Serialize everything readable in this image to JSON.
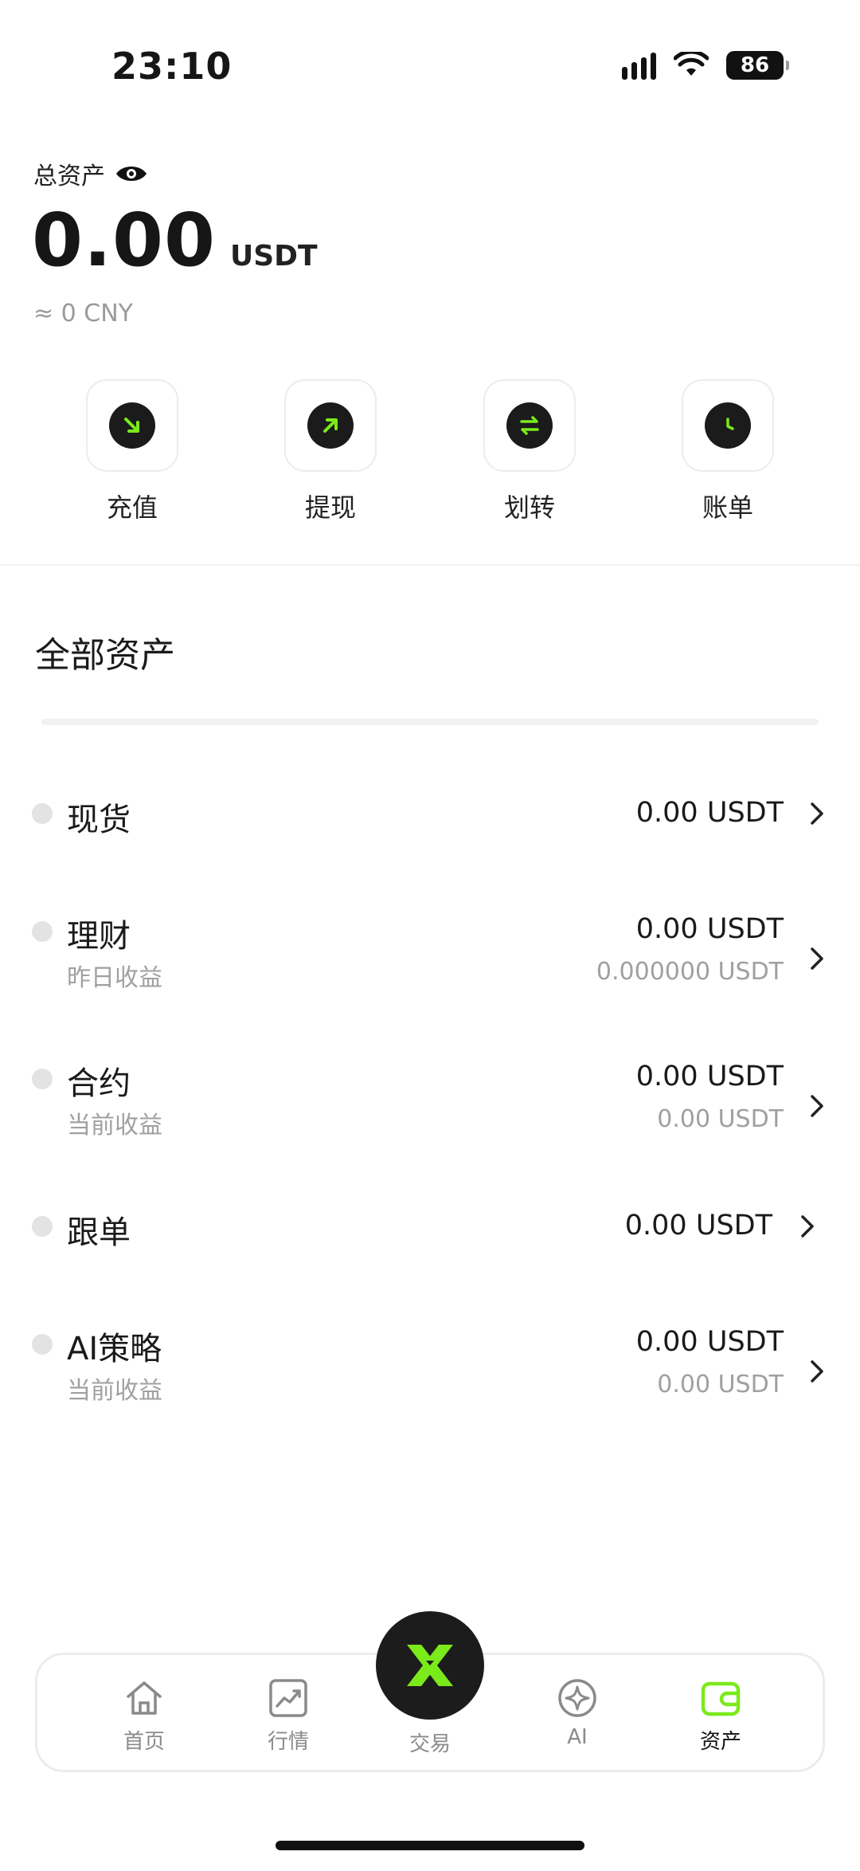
{
  "status_bar": {
    "time": "23:10",
    "battery": "86"
  },
  "header": {
    "total_label": "总资产",
    "total_amount": "0.00",
    "total_unit": "USDT",
    "total_cny": "≈ 0 CNY"
  },
  "actions": [
    {
      "label": "充值",
      "icon": "deposit-arrow-icon"
    },
    {
      "label": "提现",
      "icon": "withdraw-arrow-icon"
    },
    {
      "label": "划转",
      "icon": "transfer-icon"
    },
    {
      "label": "账单",
      "icon": "clock-icon"
    }
  ],
  "section": {
    "title": "全部资产"
  },
  "assets": [
    {
      "name": "现货",
      "value": "0.00 USDT",
      "sub_label": "",
      "sub_value": ""
    },
    {
      "name": "理财",
      "value": "0.00 USDT",
      "sub_label": "昨日收益",
      "sub_value": "0.000000 USDT"
    },
    {
      "name": "合约",
      "value": "0.00 USDT",
      "sub_label": "当前收益",
      "sub_value": "0.00 USDT"
    },
    {
      "name": "跟单",
      "value": "0.00 USDT",
      "sub_label": "",
      "sub_value": ""
    },
    {
      "name": "AI策略",
      "value": "0.00 USDT",
      "sub_label": "当前收益",
      "sub_value": "0.00 USDT"
    }
  ],
  "tabbar": {
    "items": [
      {
        "label": "首页",
        "icon": "home-icon"
      },
      {
        "label": "行情",
        "icon": "market-chart-icon"
      },
      {
        "label": "交易",
        "icon": "trade-x-icon"
      },
      {
        "label": "AI",
        "icon": "ai-sparkle-icon"
      },
      {
        "label": "资产",
        "icon": "wallet-icon"
      }
    ],
    "active": "资产"
  },
  "colors": {
    "accent": "#7bea1a",
    "dark": "#1b1b1b",
    "muted": "#a0a0a0"
  }
}
